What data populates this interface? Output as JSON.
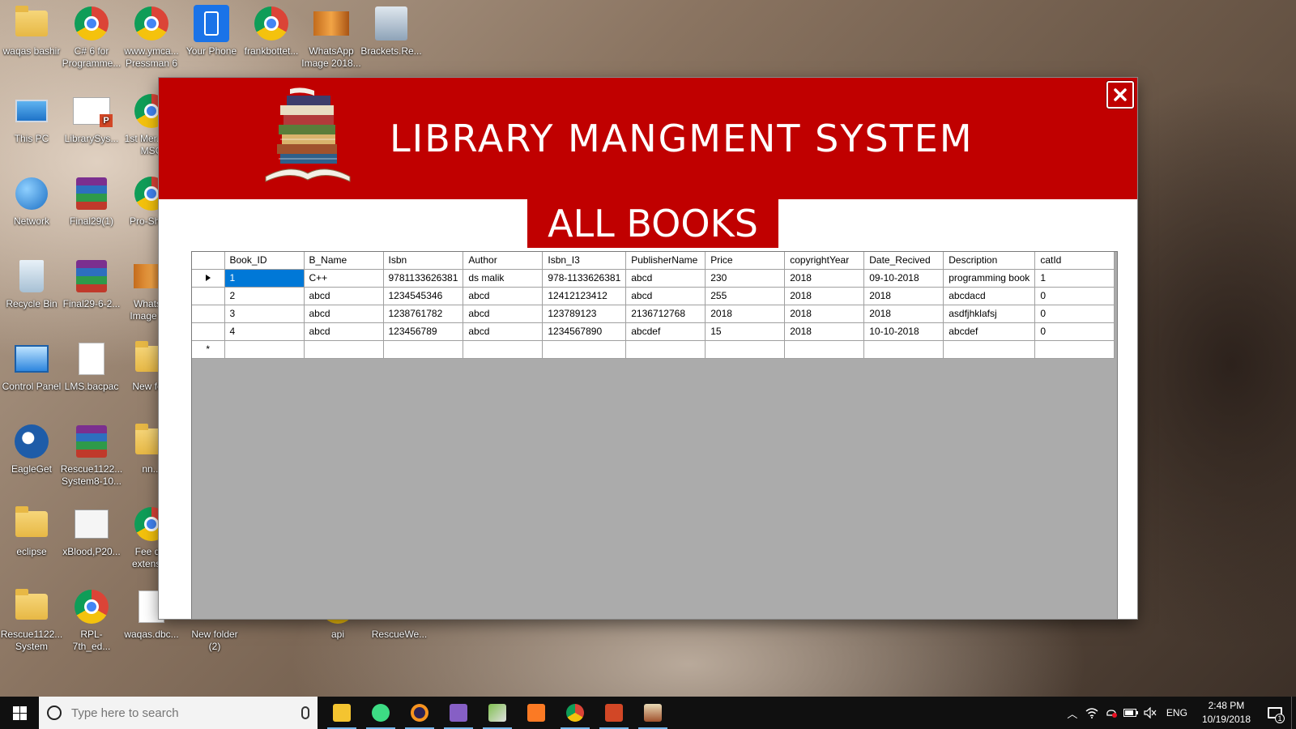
{
  "desktop": {
    "icons": [
      {
        "label": "waqas bashir",
        "glyph": "user-folder-icon"
      },
      {
        "label": "C# 6 for Programme...",
        "glyph": "chrome-icon"
      },
      {
        "label": "www.ymca... Pressman 6",
        "glyph": "chrome-icon"
      },
      {
        "label": "Your Phone",
        "glyph": "phone-icon"
      },
      {
        "label": "frankbottet...",
        "glyph": "chrome-icon"
      },
      {
        "label": "WhatsApp Image 2018...",
        "glyph": "image-icon"
      },
      {
        "label": "Brackets.Re...",
        "glyph": "installer-icon"
      },
      {
        "label": "This PC",
        "glyph": "computer-icon"
      },
      {
        "label": "LibrarySys...",
        "glyph": "powerpoint-icon"
      },
      {
        "label": "1st Mer... for MSC",
        "glyph": "chrome-icon"
      },
      {
        "label": "Network",
        "glyph": "network-icon"
      },
      {
        "label": "Final29(1)",
        "glyph": "winrar-icon"
      },
      {
        "label": "Pro-Sha...",
        "glyph": "chrome-icon"
      },
      {
        "label": "Recycle Bin",
        "glyph": "recycle-bin-icon"
      },
      {
        "label": "Final29-6-2...",
        "glyph": "winrar-icon"
      },
      {
        "label": "Whats... Image 2...",
        "glyph": "image-icon"
      },
      {
        "label": "Control Panel",
        "glyph": "control-panel-icon"
      },
      {
        "label": "LMS.bacpac",
        "glyph": "file-icon"
      },
      {
        "label": "New fo...",
        "glyph": "folder-icon"
      },
      {
        "label": "EagleGet",
        "glyph": "eagleget-icon"
      },
      {
        "label": "Rescue1122... System8-10...",
        "glyph": "winrar-icon"
      },
      {
        "label": "nn...",
        "glyph": "folder-icon"
      },
      {
        "label": "eclipse",
        "glyph": "folder-icon"
      },
      {
        "label": "xBlood,P20...",
        "glyph": "document-icon"
      },
      {
        "label": "Fee d... extensi...",
        "glyph": "chrome-icon"
      },
      {
        "label": "Rescue1122... System",
        "glyph": "folder-icon"
      },
      {
        "label": "RPL-7th_ed...",
        "glyph": "chrome-icon"
      },
      {
        "label": "waqas.dbc...",
        "glyph": "file-icon"
      },
      {
        "label": "New folder (2)",
        "glyph": "folder-icon"
      },
      {
        "label": "api",
        "glyph": "chrome-icon"
      },
      {
        "label": "RescueWe...",
        "glyph": "folder-icon"
      }
    ]
  },
  "app": {
    "banner_title": "LIBRARY MANGMENT SYSTEM",
    "heading": "ALL BOOKS",
    "accent_color": "#c00000",
    "grid": {
      "columns": [
        "Book_ID",
        "B_Name",
        "Isbn",
        "Author",
        "Isbn_I3",
        "PublisherName",
        "Price",
        "copyrightYear",
        "Date_Recived",
        "Description",
        "catId"
      ],
      "rows": [
        [
          "1",
          "C++",
          "9781133626381",
          "ds malik",
          "978-1133626381",
          "abcd",
          "230",
          "2018",
          "09-10-2018",
          "programming book",
          "1"
        ],
        [
          "2",
          "abcd",
          "1234545346",
          "abcd",
          "12412123412",
          "abcd",
          "255",
          "2018",
          "2018",
          "abcdacd",
          "0"
        ],
        [
          "3",
          "abcd",
          "1238761782",
          "abcd",
          "123789123",
          "2136712768",
          "2018",
          "2018",
          "2018",
          "asdfjhklafsj",
          "0"
        ],
        [
          "4",
          "abcd",
          "123456789",
          "abcd",
          "1234567890",
          "abcdef",
          "15",
          "2018",
          "10-10-2018",
          "abcdef",
          "0"
        ]
      ],
      "current_row_marker": "▶",
      "new_row_marker": "*"
    }
  },
  "taskbar": {
    "search_placeholder": "Type here to search",
    "apps": [
      "file-explorer-icon",
      "android-studio-icon",
      "eclipse-icon",
      "visual-studio-icon",
      "tools-icon",
      "xampp-icon",
      "chrome-icon",
      "powerpoint-icon",
      "library-app-icon"
    ],
    "language": "ENG",
    "time": "2:48 PM",
    "date": "10/19/2018",
    "notification_count": "1"
  }
}
